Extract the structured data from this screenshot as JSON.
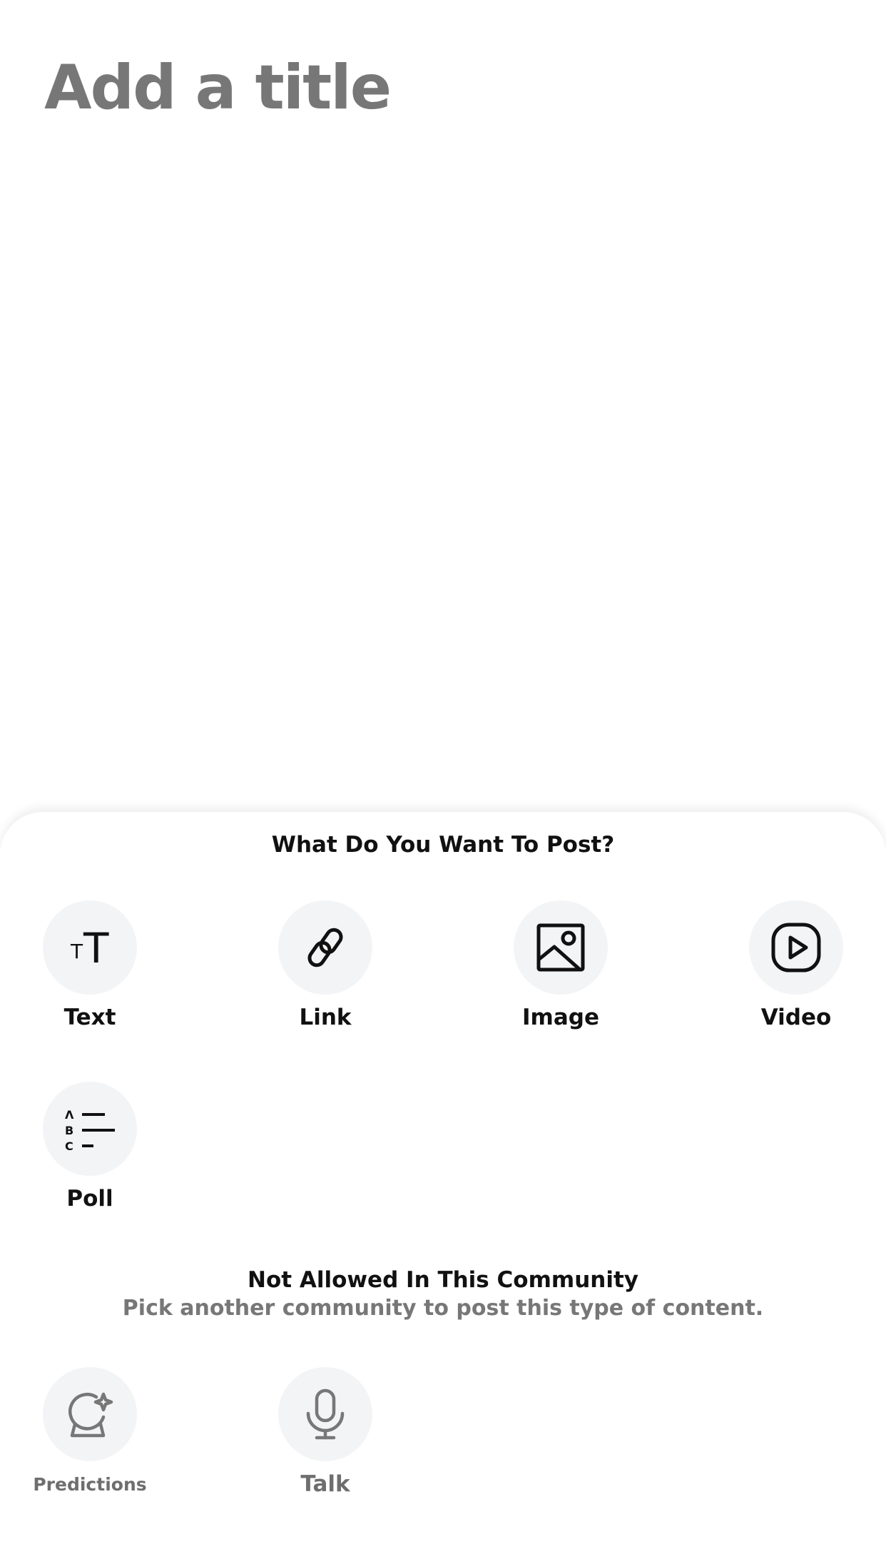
{
  "title_input": {
    "placeholder": "Add a title",
    "value": ""
  },
  "sheet": {
    "heading": "What Do You Want To Post?",
    "options": [
      {
        "label": "Text",
        "icon": "text-icon"
      },
      {
        "label": "Link",
        "icon": "link-icon"
      },
      {
        "label": "Image",
        "icon": "image-icon"
      },
      {
        "label": "Video",
        "icon": "video-icon"
      },
      {
        "label": "Poll",
        "icon": "poll-icon"
      }
    ],
    "notice": {
      "title": "Not Allowed In This Community",
      "subtitle": "Pick another community to post this type of content."
    },
    "disabled_options": [
      {
        "label": "Predictions",
        "icon": "crystal-ball-icon"
      },
      {
        "label": "Talk",
        "icon": "microphone-icon"
      }
    ]
  },
  "colors": {
    "icon_bg": "#f3f4f6",
    "text_primary": "#111111",
    "text_muted": "#777777"
  }
}
